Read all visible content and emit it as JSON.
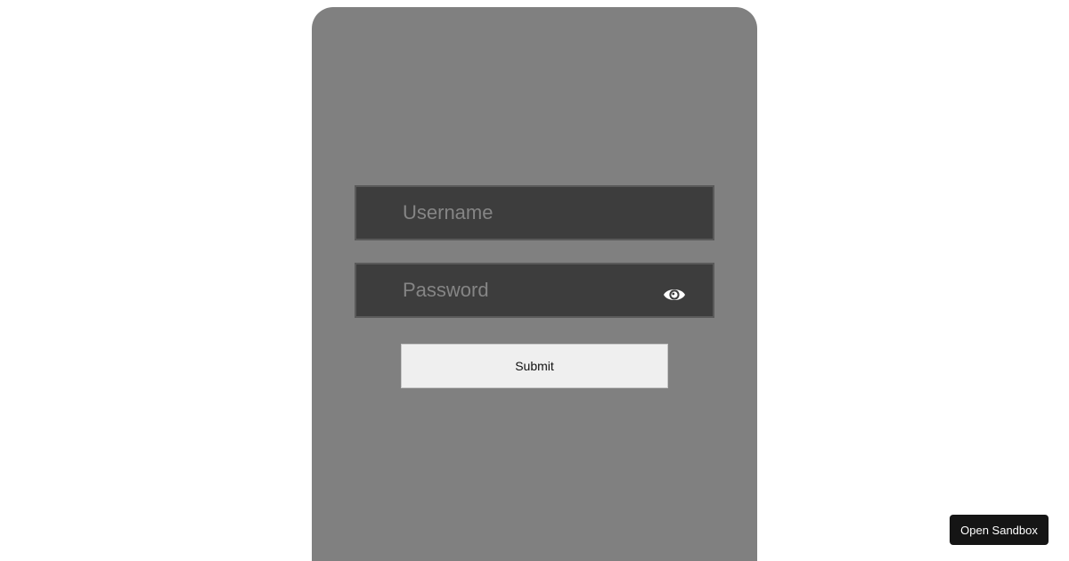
{
  "login_form": {
    "username": {
      "placeholder": "Username",
      "value": ""
    },
    "password": {
      "placeholder": "Password",
      "value": "",
      "toggle_icon": "eye-icon"
    },
    "submit_label": "Submit"
  },
  "sandbox_button_label": "Open Sandbox",
  "colors": {
    "page_background": "#ffffff",
    "card_background": "#808080",
    "input_background": "#3d3d3d",
    "input_border": "#5a5a5a",
    "placeholder_text": "#858585",
    "submit_background": "#efefef",
    "sandbox_button_background": "#151515"
  }
}
